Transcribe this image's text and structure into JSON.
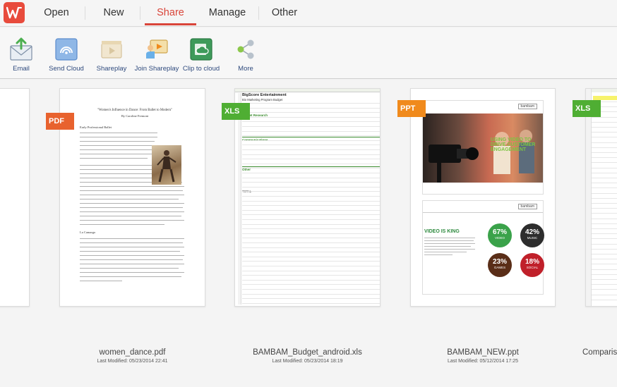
{
  "menu": {
    "tabs": [
      {
        "label": "Open"
      },
      {
        "label": "New"
      },
      {
        "label": "Share"
      },
      {
        "label": "Manage"
      },
      {
        "label": "Other"
      }
    ],
    "active_tab": "Share"
  },
  "toolbar": {
    "items": [
      {
        "label": "Email",
        "icon": "email-icon"
      },
      {
        "label": "Send Cloud",
        "icon": "send-cloud-icon"
      },
      {
        "label": "Shareplay",
        "icon": "shareplay-icon"
      },
      {
        "label": "Join Shareplay",
        "icon": "join-shareplay-icon"
      },
      {
        "label": "Clip to cloud",
        "icon": "clip-to-cloud-icon"
      },
      {
        "label": "More",
        "icon": "more-share-icon"
      }
    ]
  },
  "documents": [
    {
      "type_badge": "PDF",
      "name": "women_dance.pdf",
      "modified": "Last Modified: 05/23/2014 22:41",
      "preview_title": "\"Women's Influence in Dance: From Ballet to Modern\"",
      "preview_author": "By Caroline Fremont",
      "preview_heading1": "Early Professional Ballet",
      "preview_heading2": "La Camargo"
    },
    {
      "type_badge": "XLS",
      "name": "BAMBAM_Budget_android.xls",
      "modified": "Last Modified: 05/23/2014 18:19",
      "preview_title": "BigScore Entertainment",
      "preview_subtitle": "Bio Marketing Program Budget",
      "preview_section1": "Market Research",
      "preview_section2": "Communications",
      "preview_section3": "Other",
      "preview_total": "TOTAL"
    },
    {
      "type_badge": "PPT",
      "name": "BAMBAM_NEW.ppt",
      "modified": "Last Modified: 05/12/2014 17:25",
      "slide1_text": "USING VIDEO TO DRIVE CUSTOMER ENGAGEMENT",
      "slide2_title": "VIDEO IS KING",
      "stats": [
        {
          "value": "67%",
          "label": "VIDEO",
          "color": "#3aa24a"
        },
        {
          "value": "42%",
          "label": "MUSIC",
          "color": "#2d2d2d"
        },
        {
          "value": "23%",
          "label": "GAMES",
          "color": "#5a2e18"
        },
        {
          "value": "18%",
          "label": "SOCIAL",
          "color": "#c0202a"
        }
      ],
      "logo_text": "bambam"
    },
    {
      "type_badge": "XLS",
      "name": "Comparis",
      "modified": ""
    }
  ],
  "colors": {
    "accent": "#d9453a",
    "pdf_badge": "#e8622e",
    "xls_badge": "#4fae33",
    "ppt_badge": "#f08a1c"
  }
}
